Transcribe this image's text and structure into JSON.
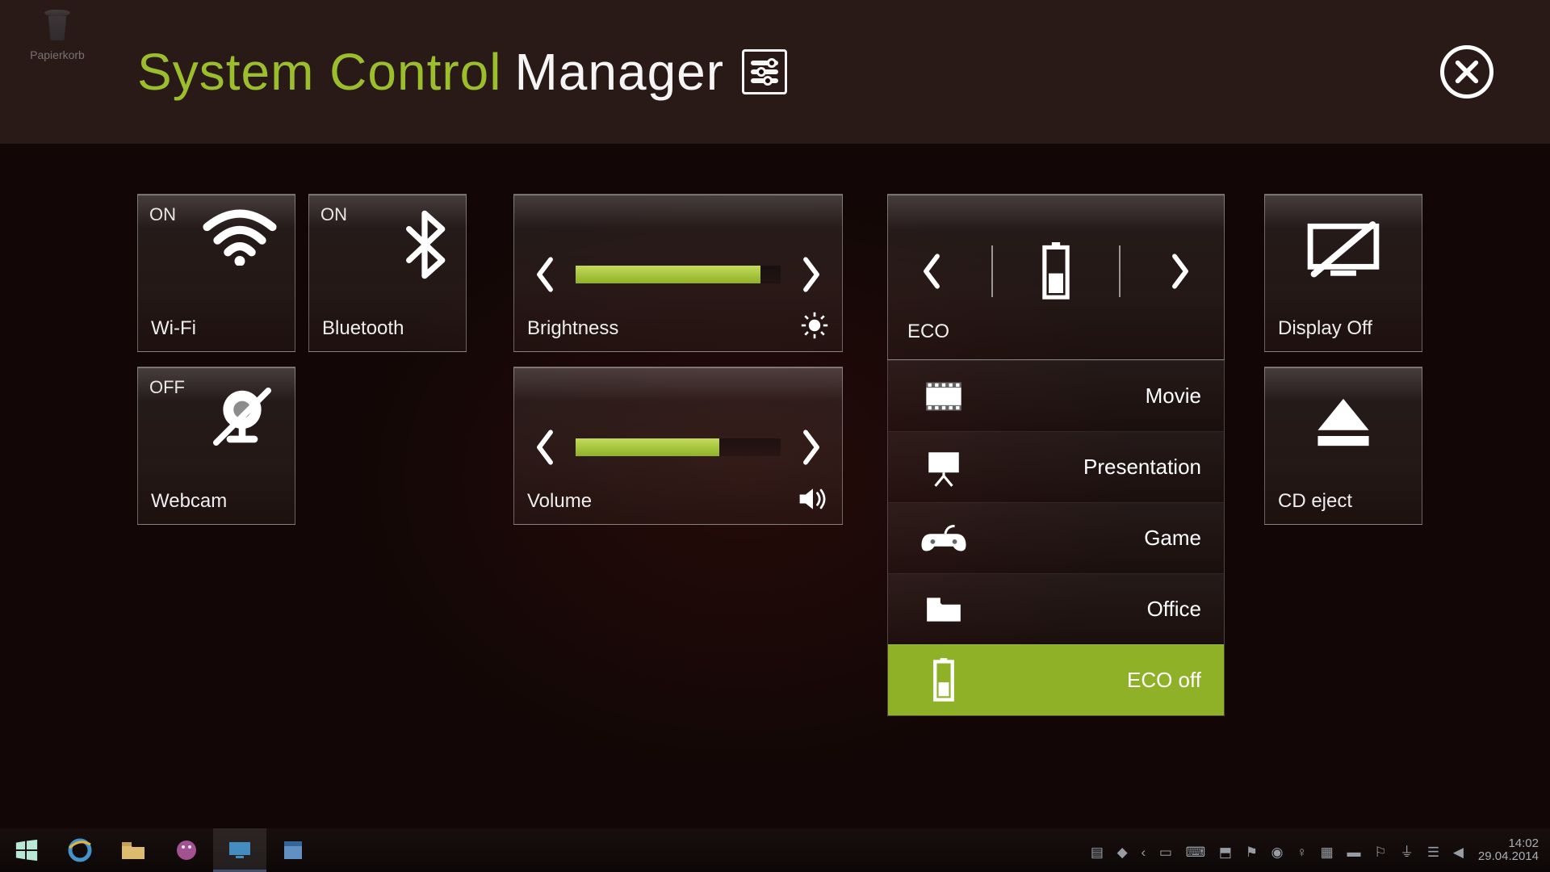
{
  "desktop": {
    "recycle_bin_label": "Papierkorb"
  },
  "header": {
    "title_accent": "System Control",
    "title_rest": "Manager"
  },
  "tiles": {
    "wifi": {
      "state": "ON",
      "label": "Wi-Fi"
    },
    "bluetooth": {
      "state": "ON",
      "label": "Bluetooth"
    },
    "webcam": {
      "state": "OFF",
      "label": "Webcam"
    },
    "brightness": {
      "label": "Brightness",
      "value_pct": 90
    },
    "volume": {
      "label": "Volume",
      "value_pct": 70
    },
    "display_off": {
      "label": "Display Off"
    },
    "cd_eject": {
      "label": "CD eject"
    }
  },
  "eco": {
    "label": "ECO",
    "items": [
      {
        "key": "movie",
        "label": "Movie",
        "selected": false
      },
      {
        "key": "presentation",
        "label": "Presentation",
        "selected": false
      },
      {
        "key": "game",
        "label": "Game",
        "selected": false
      },
      {
        "key": "office",
        "label": "Office",
        "selected": false
      },
      {
        "key": "eco_off",
        "label": "ECO off",
        "selected": true
      }
    ]
  },
  "taskbar": {
    "clock_time": "14:02",
    "clock_date": "29.04.2014"
  },
  "colors": {
    "accent": "#8fb128"
  }
}
